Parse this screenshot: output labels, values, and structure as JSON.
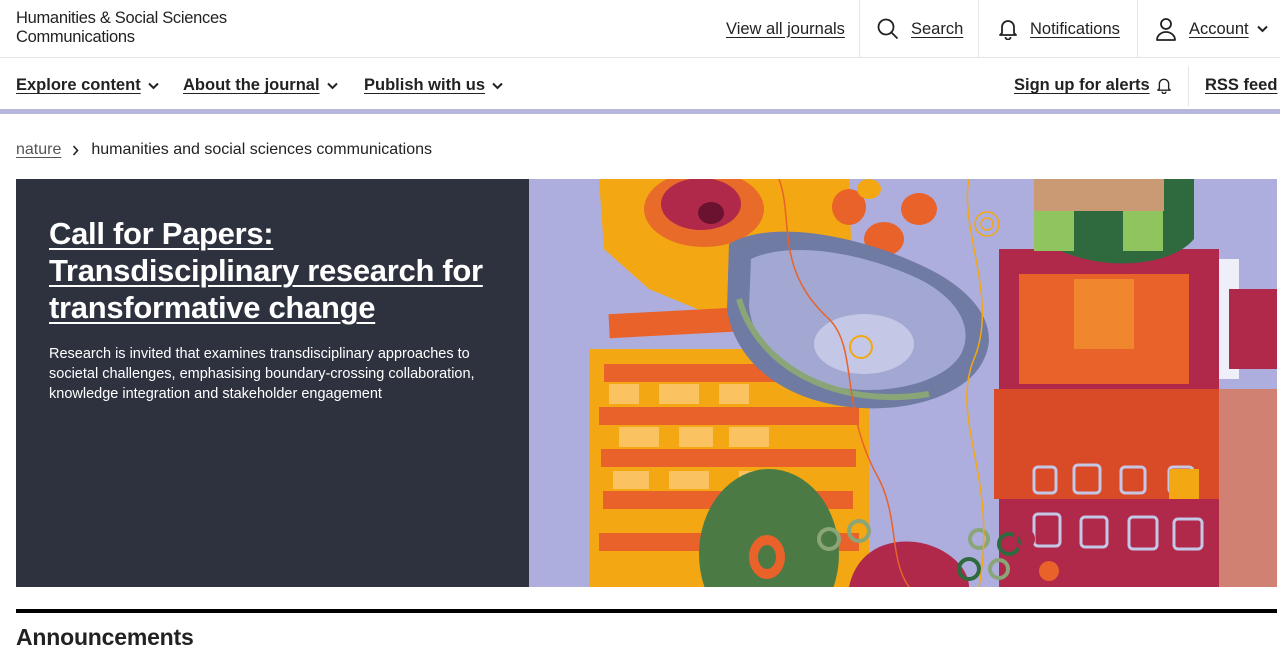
{
  "site": {
    "name_line1": "Humanities & Social Sciences",
    "name_line2": "Communications"
  },
  "topbar": {
    "view_all_journals": "View all journals",
    "search": "Search",
    "notifications": "Notifications",
    "account": "Account"
  },
  "nav": {
    "items": [
      {
        "label": "Explore content",
        "icon": "chevron-down-icon"
      },
      {
        "label": "About the journal",
        "icon": "chevron-down-icon"
      },
      {
        "label": "Publish with us",
        "icon": "chevron-down-icon"
      }
    ],
    "alerts": "Sign up for alerts",
    "rss": "RSS feed"
  },
  "breadcrumb": {
    "root": "nature",
    "current": "humanities and social sciences communications"
  },
  "hero": {
    "title": "Call for Papers: Transdisciplinary research for transformative change",
    "description": "Research is invited that examines transdisciplinary approaches to societal challenges, emphasising boundary-crossing collaboration, knowledge integration and stakeholder engagement"
  },
  "section": {
    "title": "Announcements"
  },
  "colors": {
    "hero_panel": "#2e323f",
    "nav_border": "#b5b8dc",
    "art_background": "#aeaede"
  }
}
